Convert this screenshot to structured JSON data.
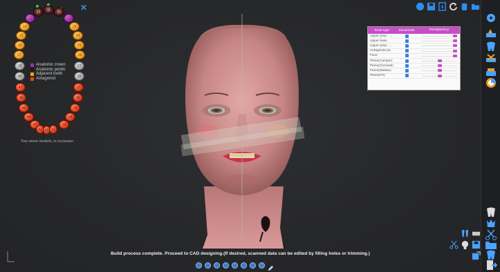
{
  "window": {
    "minimize": "–",
    "restore": "▫",
    "close": "×"
  },
  "chart": {
    "close_label": "✕",
    "legend": [
      {
        "label": "Anatomic crown",
        "color": "#a32ca8"
      },
      {
        "label": "Anatomic pontic",
        "color": "#1b1b1b"
      },
      {
        "label": "Adjacent tooth",
        "color": "#f0a21e"
      },
      {
        "label": "Antagonist",
        "color": "#e24a1c"
      }
    ],
    "caption": "Two stone models, in occlusion",
    "upper_teeth": [
      "18",
      "17",
      "16",
      "15",
      "14",
      "13",
      "12",
      "11",
      "21",
      "22",
      "23",
      "24",
      "25",
      "26",
      "27",
      "28"
    ],
    "lower_teeth": [
      "48",
      "47",
      "46",
      "45",
      "44",
      "43",
      "42",
      "41",
      "31",
      "32",
      "33",
      "34",
      "35",
      "36",
      "37",
      "38"
    ]
  },
  "visibility_panel": {
    "headers": [
      "Tooth type",
      "Show/Hide",
      "Transparency"
    ],
    "rows": [
      {
        "name": "Upper prep - ...",
        "checked": true,
        "transparency": 1.0
      },
      {
        "name": "Upper base",
        "checked": true,
        "transparency": 1.0
      },
      {
        "name": "Upper prep - ...",
        "checked": true,
        "transparency": 1.0
      },
      {
        "name": "Antagonist (lo...",
        "checked": true,
        "transparency": 1.0
      },
      {
        "name": "Face",
        "checked": true,
        "transparency": 1.0
      },
      {
        "name": "Plane(Camper)",
        "checked": true,
        "transparency": 0.5
      },
      {
        "name": "Plane(Occlusal)",
        "checked": true,
        "transparency": 0.5
      },
      {
        "name": "Plane(Midline)",
        "checked": true,
        "transparency": 0.5
      },
      {
        "name": "Plane(FH)",
        "checked": true,
        "transparency": 0.5
      }
    ]
  },
  "status_message": "Build process complete. Proceed to CAD designing.(If desired, scanned data can be edited by filling holes or trimming.)",
  "colors": {
    "accent": "#c64ec6",
    "checkbox": "#3b7fdc",
    "tool_blue": "#4aa3ff"
  }
}
